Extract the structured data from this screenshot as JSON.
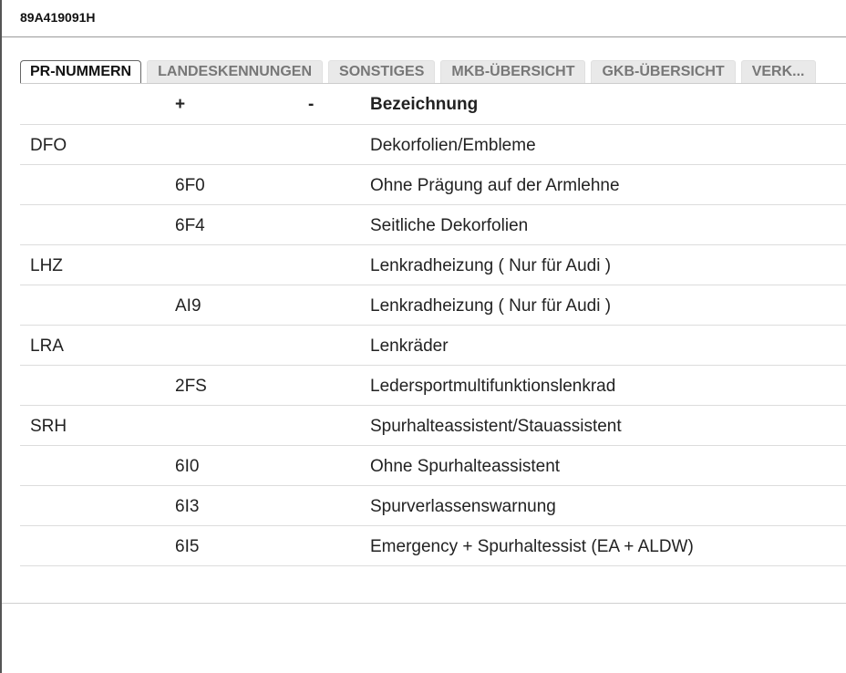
{
  "window": {
    "title": "89A419091H"
  },
  "tabs": [
    {
      "label": "PR-NUMMERN",
      "active": true
    },
    {
      "label": "LANDESKENNUNGEN",
      "active": false
    },
    {
      "label": "SONSTIGES",
      "active": false
    },
    {
      "label": "MKB-ÜBERSICHT",
      "active": false
    },
    {
      "label": "GKB-ÜBERSICHT",
      "active": false
    },
    {
      "label": "VERK...",
      "active": false
    }
  ],
  "table": {
    "headers": {
      "code": "",
      "plus": "+",
      "minus": "-",
      "description": "Bezeichnung"
    },
    "rows": [
      {
        "code": "DFO",
        "plus": "",
        "minus": "",
        "description": "Dekorfolien/Embleme"
      },
      {
        "code": "",
        "plus": "6F0",
        "minus": "",
        "description": "Ohne Prägung auf der Armlehne"
      },
      {
        "code": "",
        "plus": "6F4",
        "minus": "",
        "description": "Seitliche Dekorfolien"
      },
      {
        "code": "LHZ",
        "plus": "",
        "minus": "",
        "description": "Lenkradheizung ( Nur für Audi )"
      },
      {
        "code": "",
        "plus": "AI9",
        "minus": "",
        "description": "Lenkradheizung ( Nur für Audi )"
      },
      {
        "code": "LRA",
        "plus": "",
        "minus": "",
        "description": "Lenkräder"
      },
      {
        "code": "",
        "plus": "2FS",
        "minus": "",
        "description": "Ledersportmultifunktionslenkrad"
      },
      {
        "code": "SRH",
        "plus": "",
        "minus": "",
        "description": "Spurhalteassistent/Stauassistent"
      },
      {
        "code": "",
        "plus": "6I0",
        "minus": "",
        "description": "Ohne Spurhalteassistent"
      },
      {
        "code": "",
        "plus": "6I3",
        "minus": "",
        "description": "Spurverlassenswarnung"
      },
      {
        "code": "",
        "plus": "6I5",
        "minus": "",
        "description": "Emergency + Spurhaltessist (EA + ALDW)"
      }
    ]
  }
}
